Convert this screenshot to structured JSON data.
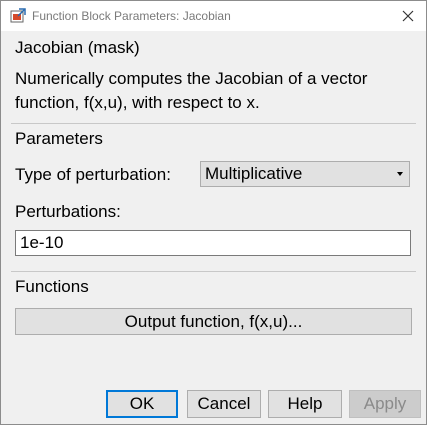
{
  "window": {
    "title": "Function Block Parameters: Jacobian"
  },
  "block": {
    "title": "Jacobian (mask)",
    "description": "Numerically computes the Jacobian of a vector function, f(x,u), with respect to x."
  },
  "parameters": {
    "section_title": "Parameters",
    "perturbation_type_label": "Type of perturbation:",
    "perturbation_type_value": "Multiplicative",
    "perturbations_label": "Perturbations:",
    "perturbations_value": "1e-10"
  },
  "functions": {
    "section_title": "Functions",
    "output_function_button": "Output function, f(x,u)..."
  },
  "buttons": {
    "ok": "OK",
    "cancel": "Cancel",
    "help": "Help",
    "apply": "Apply"
  },
  "icons": {
    "app": "simulink-block-icon",
    "close": "close-icon",
    "dropdown": "chevron-down-icon"
  },
  "colors": {
    "window_bg": "#f0f0f0",
    "button_bg": "#e1e1e1",
    "focus_border": "#0078d7",
    "disabled_text": "#8a8a8a"
  }
}
